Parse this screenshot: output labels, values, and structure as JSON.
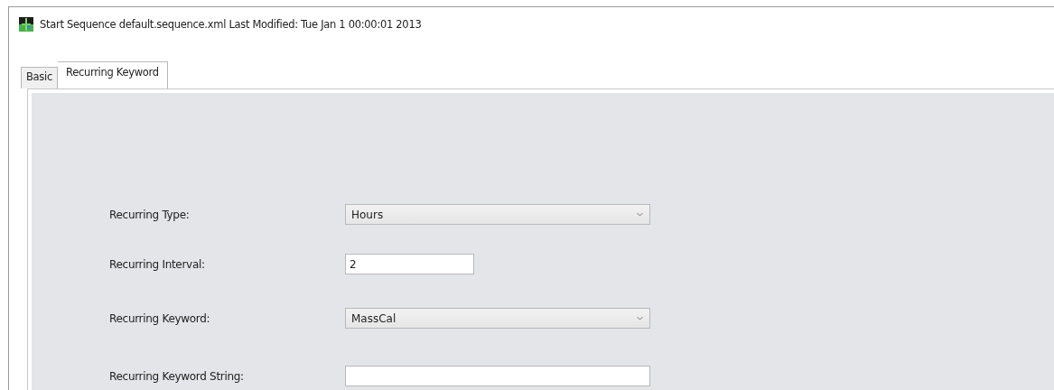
{
  "window": {
    "title": "Start Sequence default.sequence.xml  Last Modified: Tue Jan 1 00:00:01 2013"
  },
  "tabs": [
    {
      "label": "Basic",
      "selected": false
    },
    {
      "label": "Recurring Keyword",
      "selected": true
    }
  ],
  "form": [
    {
      "kind": "dropdown",
      "label": "Recurring Type:",
      "value": "Hours"
    },
    {
      "kind": "input",
      "label": "Recurring Interval:",
      "value": "2"
    },
    {
      "kind": "dropdown",
      "label": "Recurring Keyword:",
      "value": "MassCal"
    },
    {
      "kind": "wide-input",
      "label": "Recurring Keyword String:"
    }
  ]
}
